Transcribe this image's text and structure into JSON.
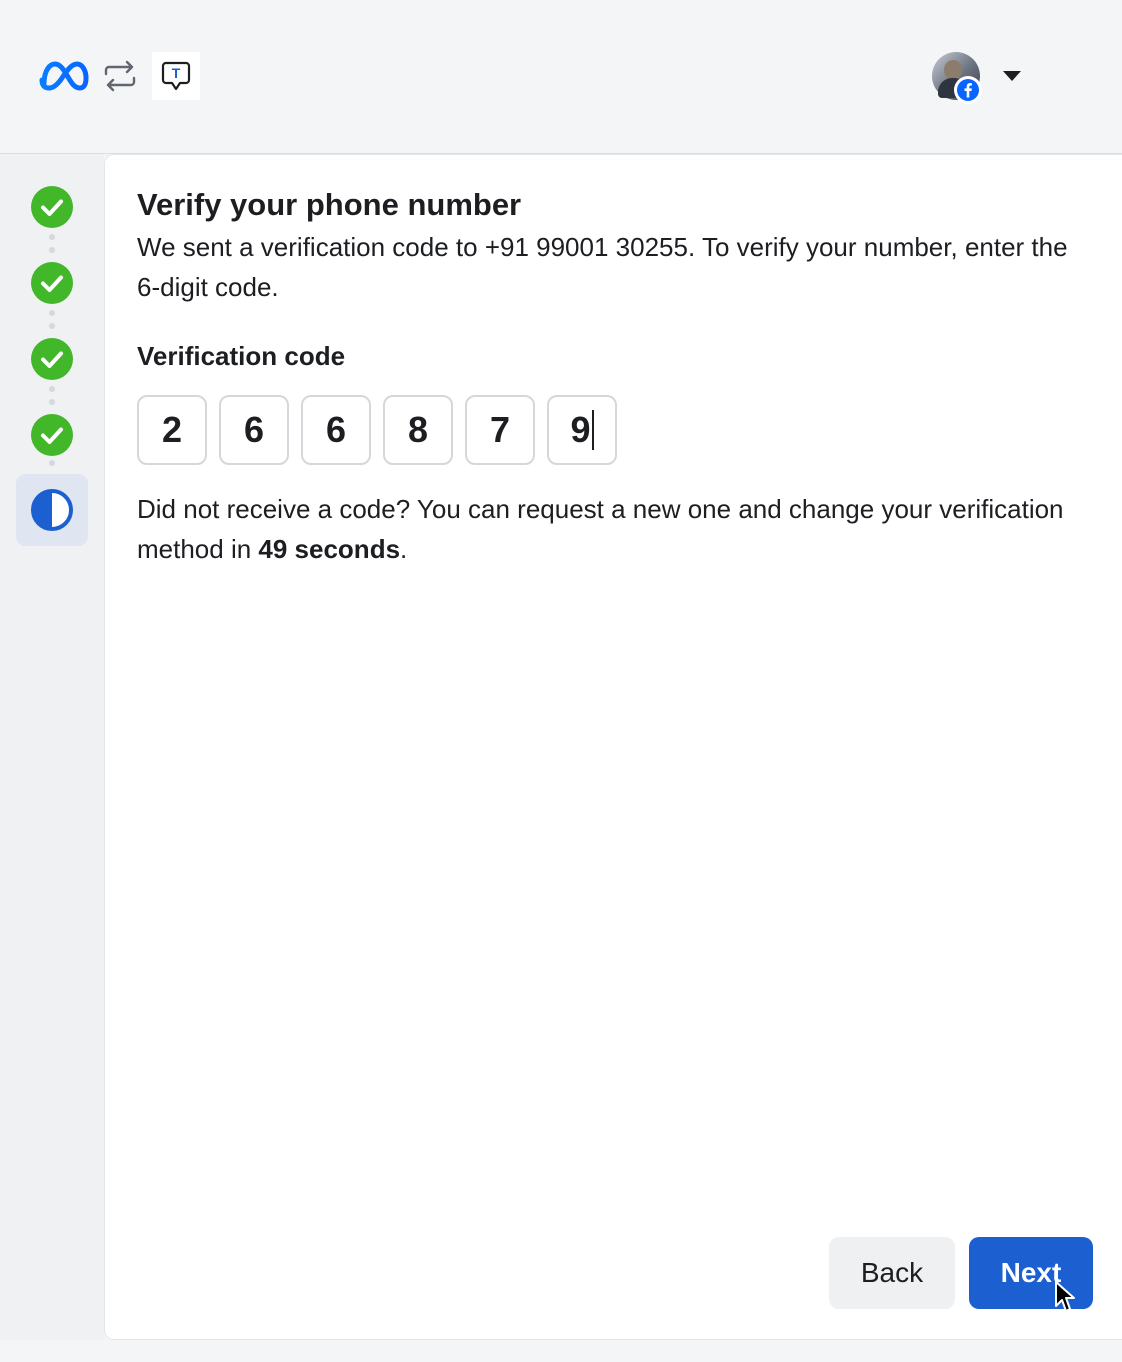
{
  "header": {
    "logo_icon": "meta-logo-icon",
    "switch_icon": "switch-accounts-icon",
    "t_icon_letter": "T",
    "account_badge_icon": "facebook-badge-icon",
    "menu_icon": "caret-down-icon"
  },
  "stepper": {
    "steps": [
      {
        "status": "complete",
        "icon": "check-circle-icon"
      },
      {
        "status": "complete",
        "icon": "check-circle-icon"
      },
      {
        "status": "complete",
        "icon": "check-circle-icon"
      },
      {
        "status": "complete",
        "icon": "check-circle-icon"
      },
      {
        "status": "in-progress",
        "icon": "half-circle-icon"
      }
    ]
  },
  "main": {
    "title": "Verify your phone number",
    "description": "We sent a verification code to +91 99001 30255. To verify your number, enter the 6-digit code.",
    "code_label": "Verification code",
    "code_digits": [
      "2",
      "6",
      "6",
      "8",
      "7",
      "9"
    ],
    "resend_prefix": "Did not receive a code? You can request a new one and change your verification method in ",
    "resend_countdown": "49 seconds",
    "resend_suffix": "."
  },
  "actions": {
    "back_label": "Back",
    "next_label": "Next"
  },
  "colors": {
    "accent": "#1b5fd1",
    "success": "#42b72a",
    "meta_blue": "#0866ff"
  }
}
